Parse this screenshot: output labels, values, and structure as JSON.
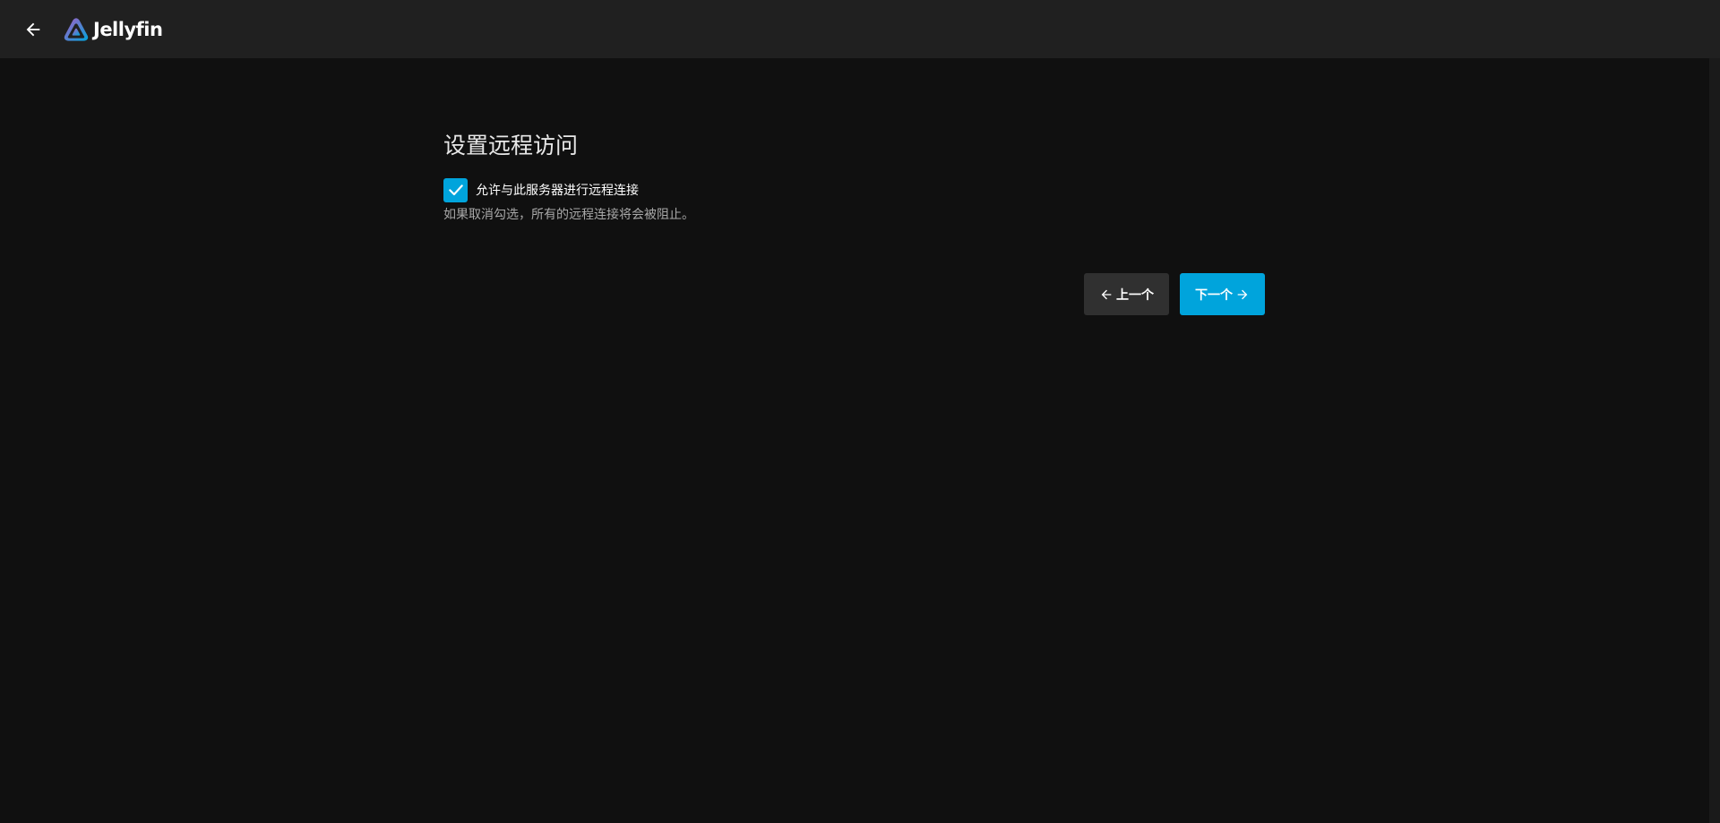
{
  "header": {
    "app_name": "Jellyfin",
    "back_icon": "arrow-left-icon",
    "logo_icon": "jellyfin-logo-icon"
  },
  "main": {
    "title": "设置远程访问",
    "remote_access": {
      "checked": true,
      "label": "允许与此服务器进行远程连接",
      "description": "如果取消勾选，所有的远程连接将会被阻止。"
    },
    "buttons": {
      "previous_label": "上一个",
      "next_label": "下一个"
    }
  },
  "colors": {
    "accent": "#00a4dc",
    "background": "#101010",
    "header": "#202020",
    "secondary_button": "#303030"
  }
}
